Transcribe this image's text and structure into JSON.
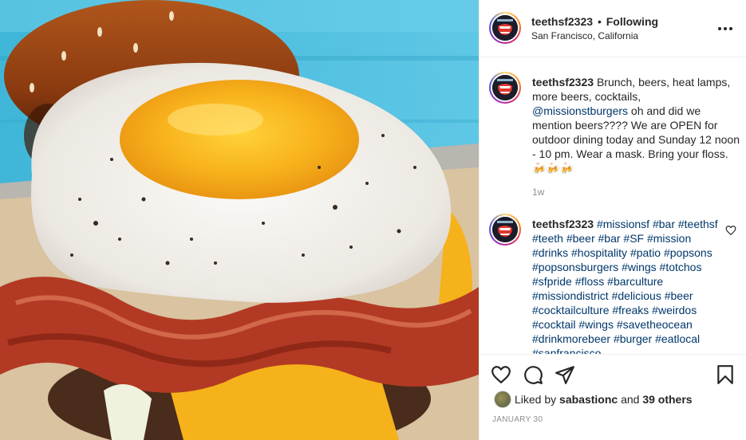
{
  "post": {
    "username": "teethsf2323",
    "separator": "•",
    "follow_status": "Following",
    "location": "San Francisco, California",
    "more_icon": "more-horizontal-icon",
    "caption": {
      "username": "teethsf2323",
      "text_before": "Brunch, beers, heat lamps, more beers, cocktails, ",
      "mention": "@missionstburgers",
      "text_after": " oh and did we mention beers???? We are OPEN for outdoor dining today and Sunday 12 noon - 10 pm. Wear a mask. Bring your floss. 🍻🍻🍻",
      "age": "1w"
    },
    "comment": {
      "username": "teethsf2323",
      "hashtags": "#missionsf #bar #teethsf #teeth #beer #bar #SF #mission #drinks #hospitality #patio #popsons #popsonsburgers #wings #totchos #sfpride #floss #barculture #missiondistrict #delicious #beer #cocktailculture #freaks #weirdos #cocktail #wings #savetheocean #drinkmorebeer #burger #eatlocal #sanfrancisco",
      "like_icon": "heart-outline-icon"
    },
    "actions": {
      "like_icon": "heart-icon",
      "comment_icon": "comment-icon",
      "share_icon": "paper-plane-icon",
      "save_icon": "bookmark-icon"
    },
    "likes": {
      "prefix": "Liked by ",
      "user": "sabastionc",
      "middle": " and ",
      "others": "39 others"
    },
    "date": "JANUARY 30",
    "colors": {
      "link": "#00376b",
      "muted": "#8e8e8e",
      "text": "#262626",
      "border": "#efefef"
    }
  }
}
